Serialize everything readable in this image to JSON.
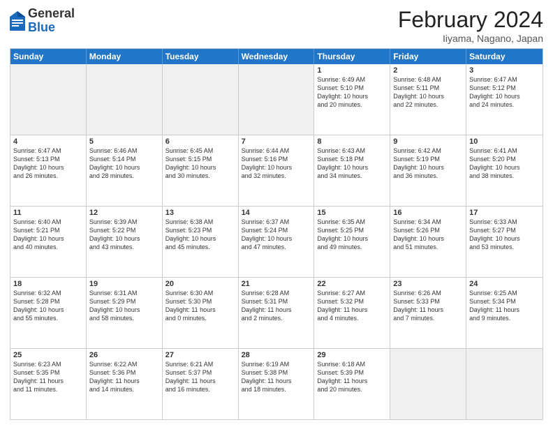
{
  "header": {
    "logo": {
      "general": "General",
      "blue": "Blue"
    },
    "title": "February 2024",
    "location": "Iiyama, Nagano, Japan"
  },
  "weekdays": [
    "Sunday",
    "Monday",
    "Tuesday",
    "Wednesday",
    "Thursday",
    "Friday",
    "Saturday"
  ],
  "rows": [
    [
      {
        "day": "",
        "info": "",
        "shaded": true
      },
      {
        "day": "",
        "info": "",
        "shaded": true
      },
      {
        "day": "",
        "info": "",
        "shaded": true
      },
      {
        "day": "",
        "info": "",
        "shaded": true
      },
      {
        "day": "1",
        "info": "Sunrise: 6:49 AM\nSunset: 5:10 PM\nDaylight: 10 hours\nand 20 minutes.",
        "shaded": false
      },
      {
        "day": "2",
        "info": "Sunrise: 6:48 AM\nSunset: 5:11 PM\nDaylight: 10 hours\nand 22 minutes.",
        "shaded": false
      },
      {
        "day": "3",
        "info": "Sunrise: 6:47 AM\nSunset: 5:12 PM\nDaylight: 10 hours\nand 24 minutes.",
        "shaded": false
      }
    ],
    [
      {
        "day": "4",
        "info": "Sunrise: 6:47 AM\nSunset: 5:13 PM\nDaylight: 10 hours\nand 26 minutes.",
        "shaded": false
      },
      {
        "day": "5",
        "info": "Sunrise: 6:46 AM\nSunset: 5:14 PM\nDaylight: 10 hours\nand 28 minutes.",
        "shaded": false
      },
      {
        "day": "6",
        "info": "Sunrise: 6:45 AM\nSunset: 5:15 PM\nDaylight: 10 hours\nand 30 minutes.",
        "shaded": false
      },
      {
        "day": "7",
        "info": "Sunrise: 6:44 AM\nSunset: 5:16 PM\nDaylight: 10 hours\nand 32 minutes.",
        "shaded": false
      },
      {
        "day": "8",
        "info": "Sunrise: 6:43 AM\nSunset: 5:18 PM\nDaylight: 10 hours\nand 34 minutes.",
        "shaded": false
      },
      {
        "day": "9",
        "info": "Sunrise: 6:42 AM\nSunset: 5:19 PM\nDaylight: 10 hours\nand 36 minutes.",
        "shaded": false
      },
      {
        "day": "10",
        "info": "Sunrise: 6:41 AM\nSunset: 5:20 PM\nDaylight: 10 hours\nand 38 minutes.",
        "shaded": false
      }
    ],
    [
      {
        "day": "11",
        "info": "Sunrise: 6:40 AM\nSunset: 5:21 PM\nDaylight: 10 hours\nand 40 minutes.",
        "shaded": false
      },
      {
        "day": "12",
        "info": "Sunrise: 6:39 AM\nSunset: 5:22 PM\nDaylight: 10 hours\nand 43 minutes.",
        "shaded": false
      },
      {
        "day": "13",
        "info": "Sunrise: 6:38 AM\nSunset: 5:23 PM\nDaylight: 10 hours\nand 45 minutes.",
        "shaded": false
      },
      {
        "day": "14",
        "info": "Sunrise: 6:37 AM\nSunset: 5:24 PM\nDaylight: 10 hours\nand 47 minutes.",
        "shaded": false
      },
      {
        "day": "15",
        "info": "Sunrise: 6:35 AM\nSunset: 5:25 PM\nDaylight: 10 hours\nand 49 minutes.",
        "shaded": false
      },
      {
        "day": "16",
        "info": "Sunrise: 6:34 AM\nSunset: 5:26 PM\nDaylight: 10 hours\nand 51 minutes.",
        "shaded": false
      },
      {
        "day": "17",
        "info": "Sunrise: 6:33 AM\nSunset: 5:27 PM\nDaylight: 10 hours\nand 53 minutes.",
        "shaded": false
      }
    ],
    [
      {
        "day": "18",
        "info": "Sunrise: 6:32 AM\nSunset: 5:28 PM\nDaylight: 10 hours\nand 55 minutes.",
        "shaded": false
      },
      {
        "day": "19",
        "info": "Sunrise: 6:31 AM\nSunset: 5:29 PM\nDaylight: 10 hours\nand 58 minutes.",
        "shaded": false
      },
      {
        "day": "20",
        "info": "Sunrise: 6:30 AM\nSunset: 5:30 PM\nDaylight: 11 hours\nand 0 minutes.",
        "shaded": false
      },
      {
        "day": "21",
        "info": "Sunrise: 6:28 AM\nSunset: 5:31 PM\nDaylight: 11 hours\nand 2 minutes.",
        "shaded": false
      },
      {
        "day": "22",
        "info": "Sunrise: 6:27 AM\nSunset: 5:32 PM\nDaylight: 11 hours\nand 4 minutes.",
        "shaded": false
      },
      {
        "day": "23",
        "info": "Sunrise: 6:26 AM\nSunset: 5:33 PM\nDaylight: 11 hours\nand 7 minutes.",
        "shaded": false
      },
      {
        "day": "24",
        "info": "Sunrise: 6:25 AM\nSunset: 5:34 PM\nDaylight: 11 hours\nand 9 minutes.",
        "shaded": false
      }
    ],
    [
      {
        "day": "25",
        "info": "Sunrise: 6:23 AM\nSunset: 5:35 PM\nDaylight: 11 hours\nand 11 minutes.",
        "shaded": false
      },
      {
        "day": "26",
        "info": "Sunrise: 6:22 AM\nSunset: 5:36 PM\nDaylight: 11 hours\nand 14 minutes.",
        "shaded": false
      },
      {
        "day": "27",
        "info": "Sunrise: 6:21 AM\nSunset: 5:37 PM\nDaylight: 11 hours\nand 16 minutes.",
        "shaded": false
      },
      {
        "day": "28",
        "info": "Sunrise: 6:19 AM\nSunset: 5:38 PM\nDaylight: 11 hours\nand 18 minutes.",
        "shaded": false
      },
      {
        "day": "29",
        "info": "Sunrise: 6:18 AM\nSunset: 5:39 PM\nDaylight: 11 hours\nand 20 minutes.",
        "shaded": false
      },
      {
        "day": "",
        "info": "",
        "shaded": true
      },
      {
        "day": "",
        "info": "",
        "shaded": true
      }
    ]
  ]
}
